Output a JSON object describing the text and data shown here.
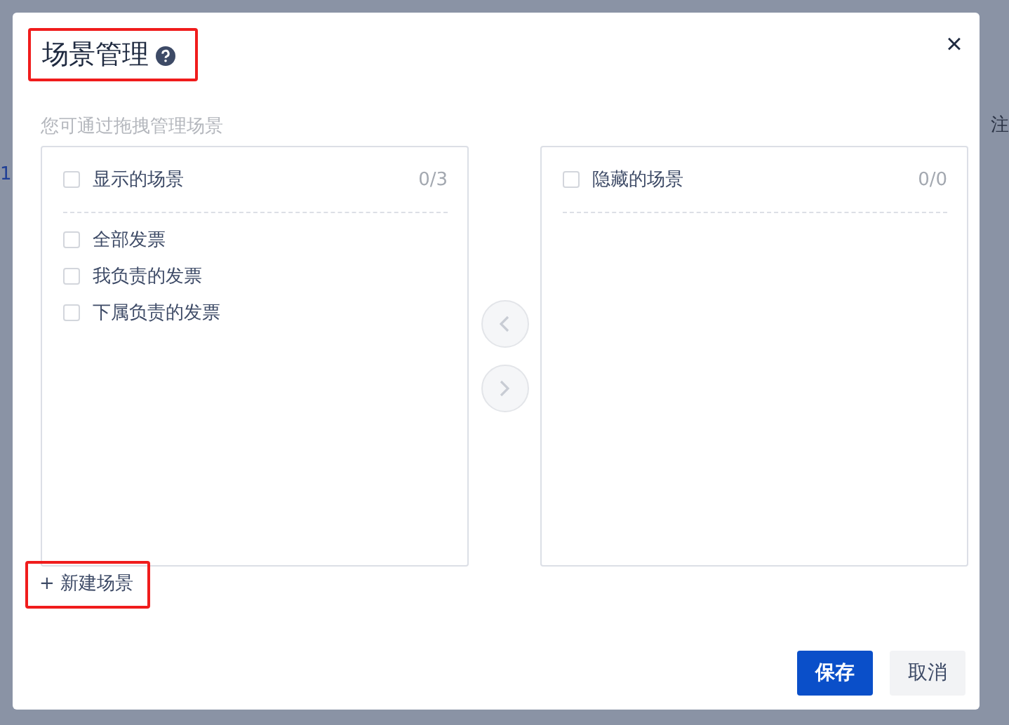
{
  "background": {
    "right_text": "注",
    "row_number": "1"
  },
  "dialog": {
    "title": "场景管理",
    "title_highlighted": true,
    "close": "×",
    "hint": "您可通过拖拽管理场景",
    "panels": [
      {
        "title": "显示的场景",
        "count": "0/3",
        "checked": false,
        "items": [
          {
            "label": "全部发票",
            "checked": false
          },
          {
            "label": "我负责的发票",
            "checked": false
          },
          {
            "label": "下属负责的发票",
            "checked": false
          }
        ]
      },
      {
        "title": "隐藏的场景",
        "count": "0/0",
        "checked": false
      }
    ],
    "transfer_buttons": [
      {
        "kind": "left",
        "disabled": true
      },
      {
        "kind": "right",
        "disabled": true
      }
    ],
    "new_button": {
      "label": "+ 新建场景",
      "highlighted": true
    },
    "buttons": [
      {
        "label": "保存",
        "kind": "primary"
      },
      {
        "label": "取消",
        "kind": "secondary"
      }
    ]
  }
}
